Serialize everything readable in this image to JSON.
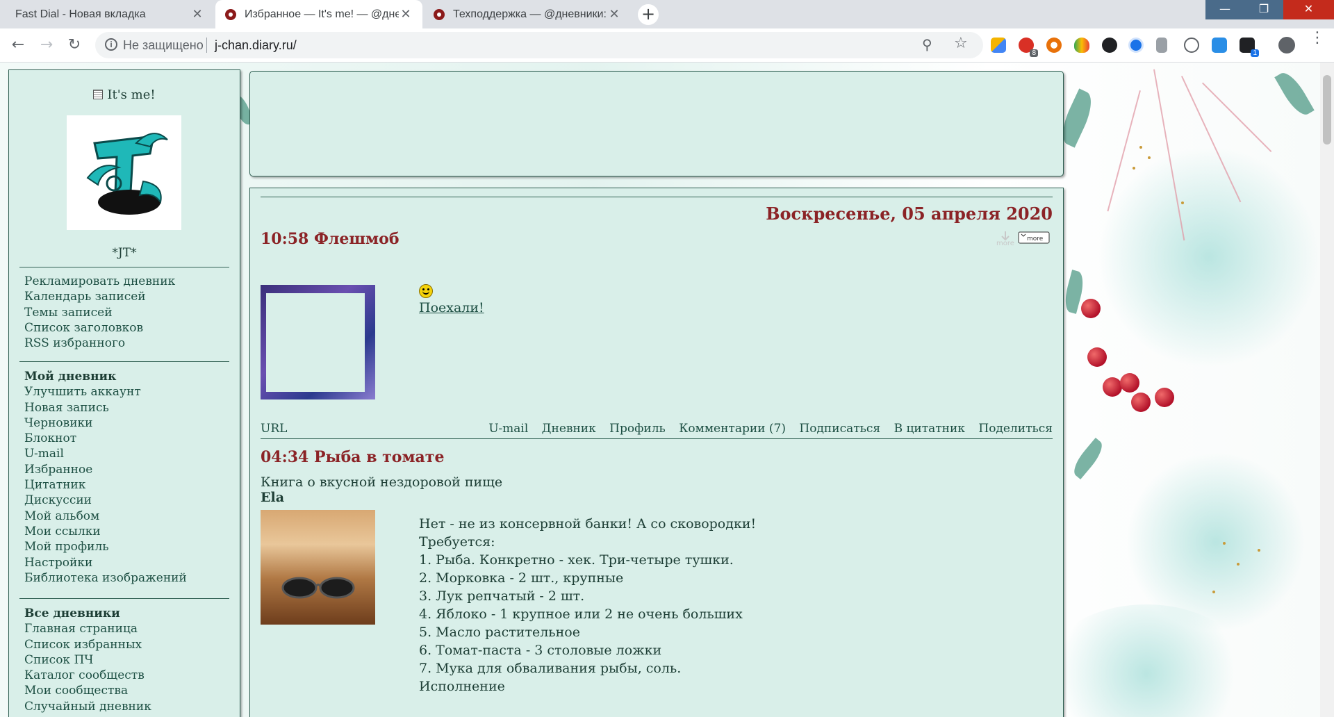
{
  "tabs": [
    {
      "title": "Fast Dial - Новая вкладка"
    },
    {
      "title": "Избранное — It's me! — @днев"
    },
    {
      "title": "Техподдержка — @дневники: а"
    }
  ],
  "address": {
    "security": "Не защищено",
    "url": "j-chan.diary.ru/"
  },
  "extensions": {
    "badge1": "8",
    "badge2": "1"
  },
  "sidebar": {
    "title": "It's me!",
    "username": "*JT*",
    "group1": [
      "Рекламировать дневник",
      "Календарь записей",
      "Темы записей",
      "Список заголовков",
      "RSS избранного"
    ],
    "my_header": "Мой дневник",
    "group2": [
      "Улучшить аккаунт",
      "Новая запись",
      "Черновики",
      "Блокнот",
      "U-mail",
      "Избранное",
      "Цитатник",
      "Дискуссии",
      "Мой альбом",
      "Мои ссылки",
      "Мой профиль",
      "Настройки",
      "Библиотека изображений"
    ],
    "all_header": "Все дневники",
    "group3": [
      "Главная страница",
      "Список избранных",
      "Список ПЧ",
      "Каталог сообществ",
      "Мои сообщества",
      "Случайный дневник"
    ]
  },
  "main": {
    "date": "Воскресенье, 05 апреля 2020",
    "post1": {
      "title": "10:58 Флешмоб",
      "more_label": "more",
      "link": "Поехали!"
    },
    "footer": {
      "url": "URL",
      "links": [
        "U-mail",
        "Дневник",
        "Профиль",
        "Комментарии (7)",
        "Подписаться",
        "В цитатник",
        "Поделиться"
      ]
    },
    "post2": {
      "title": "04:34 Рыба в томате",
      "book": "Книга о вкусной нездоровой пище",
      "author": "Ela",
      "lines": [
        "Нет - не из консервной банки! А со сковородки!",
        "Требуется:",
        "1. Рыба. Конкретно - хек. Три-четыре тушки.",
        "2. Морковка - 2 шт., крупные",
        "3. Лук репчатый - 2 шт.",
        "4. Яблоко - 1 крупное или 2 не очень больших",
        "5. Масло растительное",
        "6. Томат-паста - 3 столовые ложки",
        "7. Мука для обваливания рыбы, соль.",
        "Исполнение"
      ]
    }
  }
}
